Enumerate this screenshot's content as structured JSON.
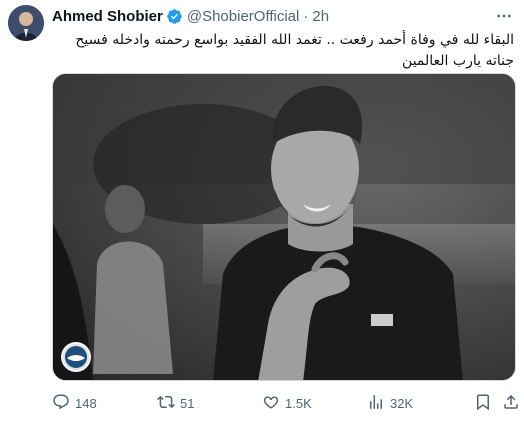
{
  "post": {
    "author_name": "Ahmed Shobier",
    "handle": "@ShobierOfficial",
    "separator": "·",
    "time": "2h",
    "text": "البقاء لله في وفاة أحمد رفعت .. تغمد الله الفقيد بواسع رحمته وادخله فسيح جناته يارب العالمين"
  },
  "metrics": {
    "replies": "148",
    "reposts": "51",
    "likes": "1.5K",
    "views": "32K"
  },
  "colors": {
    "verified": "#1d9bf0",
    "text": "#0f1419",
    "muted": "#536471"
  },
  "icons": {
    "verified": "verified-badge-icon",
    "more": "more-dots-icon",
    "reply": "reply-icon",
    "repost": "repost-icon",
    "like": "heart-icon",
    "views": "views-icon",
    "bookmark": "bookmark-icon",
    "share": "share-icon"
  }
}
